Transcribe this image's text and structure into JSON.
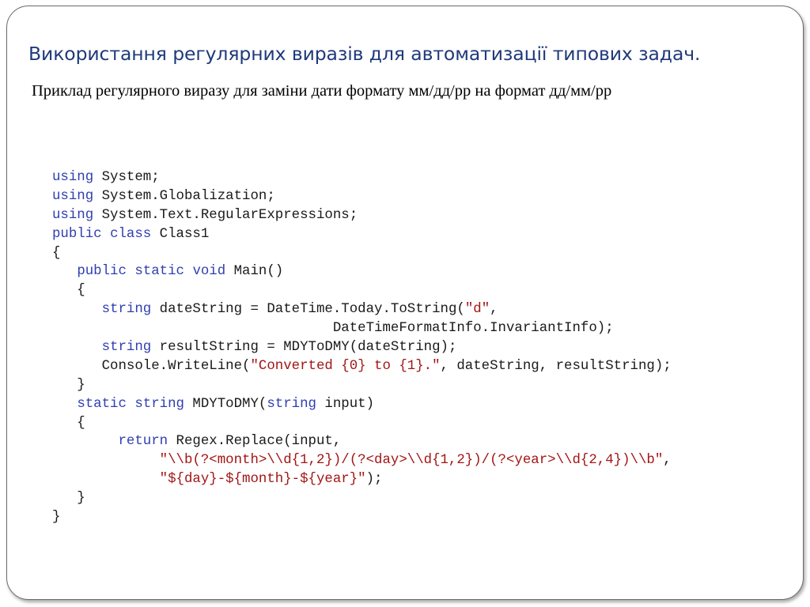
{
  "slide": {
    "title": "Використання регулярних виразів для автоматизації типових задач.",
    "subtitle": "Приклад регулярного виразу для заміни дати формату мм/дд/рр на формат дд/мм/рр"
  },
  "code": {
    "language": "C#",
    "colors": {
      "keyword": "#2f3fb0",
      "string": "#a31515",
      "text": "#1a1a1a"
    },
    "lines": [
      [
        {
          "t": "using",
          "c": "kw"
        },
        {
          "t": " System;",
          "c": "pl"
        }
      ],
      [
        {
          "t": "using",
          "c": "kw"
        },
        {
          "t": " System.Globalization;",
          "c": "pl"
        }
      ],
      [
        {
          "t": "using",
          "c": "kw"
        },
        {
          "t": " System.Text.RegularExpressions;",
          "c": "pl"
        }
      ],
      [
        {
          "t": "public",
          "c": "kw"
        },
        {
          "t": " ",
          "c": "pl"
        },
        {
          "t": "class",
          "c": "kw"
        },
        {
          "t": " Class1",
          "c": "pl"
        }
      ],
      [
        {
          "t": "{",
          "c": "pl"
        }
      ],
      [
        {
          "t": "   ",
          "c": "pl"
        },
        {
          "t": "public",
          "c": "kw"
        },
        {
          "t": " ",
          "c": "pl"
        },
        {
          "t": "static",
          "c": "kw"
        },
        {
          "t": " ",
          "c": "pl"
        },
        {
          "t": "void",
          "c": "kw"
        },
        {
          "t": " Main()",
          "c": "pl"
        }
      ],
      [
        {
          "t": "   {",
          "c": "pl"
        }
      ],
      [
        {
          "t": "      ",
          "c": "pl"
        },
        {
          "t": "string",
          "c": "kw"
        },
        {
          "t": " dateString = DateTime.Today.ToString(",
          "c": "pl"
        },
        {
          "t": "\"d\"",
          "c": "str"
        },
        {
          "t": ",",
          "c": "pl"
        }
      ],
      [
        {
          "t": "                                  DateTimeFormatInfo.InvariantInfo);",
          "c": "pl"
        }
      ],
      [
        {
          "t": "      ",
          "c": "pl"
        },
        {
          "t": "string",
          "c": "kw"
        },
        {
          "t": " resultString = MDYToDMY(dateString);",
          "c": "pl"
        }
      ],
      [
        {
          "t": "      Console.WriteLine(",
          "c": "pl"
        },
        {
          "t": "\"Converted {0} to {1}.\"",
          "c": "str"
        },
        {
          "t": ", dateString, resultString);",
          "c": "pl"
        }
      ],
      [
        {
          "t": "   }",
          "c": "pl"
        }
      ],
      [
        {
          "t": "   ",
          "c": "pl"
        },
        {
          "t": "static",
          "c": "kw"
        },
        {
          "t": " ",
          "c": "pl"
        },
        {
          "t": "string",
          "c": "kw"
        },
        {
          "t": " MDYToDMY(",
          "c": "pl"
        },
        {
          "t": "string",
          "c": "kw"
        },
        {
          "t": " input)",
          "c": "pl"
        }
      ],
      [
        {
          "t": "   {",
          "c": "pl"
        }
      ],
      [
        {
          "t": "        ",
          "c": "pl"
        },
        {
          "t": "return",
          "c": "kw"
        },
        {
          "t": " Regex.Replace(input,",
          "c": "pl"
        }
      ],
      [
        {
          "t": "             ",
          "c": "pl"
        },
        {
          "t": "\"\\\\b(?<month>\\\\d{1,2})/(?<day>\\\\d{1,2})/(?<year>\\\\d{2,4})\\\\b\"",
          "c": "str"
        },
        {
          "t": ",",
          "c": "pl"
        }
      ],
      [
        {
          "t": "             ",
          "c": "pl"
        },
        {
          "t": "\"${day}-${month}-${year}\"",
          "c": "str"
        },
        {
          "t": ");",
          "c": "pl"
        }
      ],
      [
        {
          "t": "   }",
          "c": "pl"
        }
      ],
      [
        {
          "t": "}",
          "c": "pl"
        }
      ]
    ]
  }
}
